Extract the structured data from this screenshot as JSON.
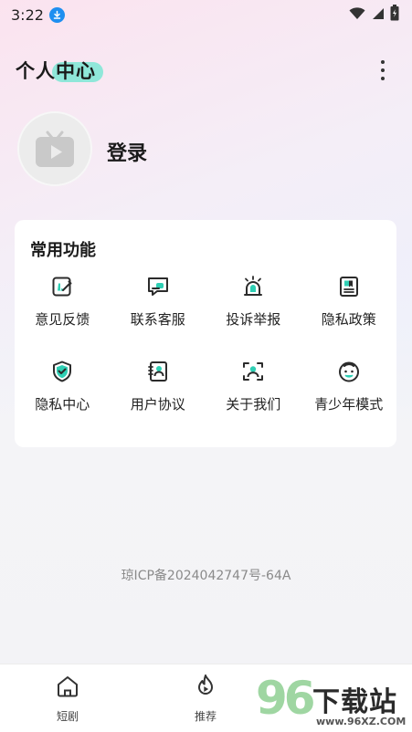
{
  "status_bar": {
    "time": "3:22",
    "icons": [
      "download-icon",
      "wifi-icon",
      "signal-icon",
      "battery-icon"
    ]
  },
  "header": {
    "title": "个人中心",
    "more_icon": "more-vertical-icon",
    "accent": "#8fe7d9"
  },
  "profile": {
    "avatar_icon": "tv-play-icon",
    "login_label": "登录"
  },
  "functions": {
    "title": "常用功能",
    "items": [
      {
        "label": "意见反馈",
        "icon": "feedback-edit-icon"
      },
      {
        "label": "联系客服",
        "icon": "customer-service-icon"
      },
      {
        "label": "投诉举报",
        "icon": "report-alarm-icon"
      },
      {
        "label": "隐私政策",
        "icon": "privacy-policy-doc-icon"
      },
      {
        "label": "隐私中心",
        "icon": "shield-check-icon"
      },
      {
        "label": "用户协议",
        "icon": "user-agreement-icon"
      },
      {
        "label": "关于我们",
        "icon": "scan-face-icon"
      },
      {
        "label": "青少年模式",
        "icon": "child-face-icon"
      }
    ]
  },
  "footer": {
    "icp": "琼ICP备2024042747号-64A"
  },
  "bottom_nav": {
    "items": [
      {
        "label": "短剧",
        "icon": "home-icon"
      },
      {
        "label": "推荐",
        "icon": "fire-play-icon"
      }
    ]
  },
  "watermark": {
    "logo": "96",
    "title": "下载站",
    "url": "www.96XZ.COM"
  },
  "colors": {
    "accent": "#2fcfb4",
    "icon_dark": "#2b2b2b"
  }
}
